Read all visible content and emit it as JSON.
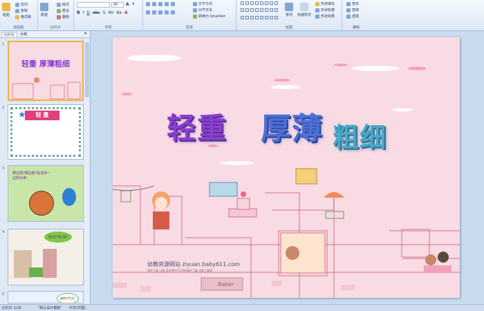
{
  "ribbon": {
    "clipboard": {
      "paste": "粘贴",
      "cut": "剪切",
      "copy": "复制",
      "format_painter": "格式刷",
      "label": "剪贴板"
    },
    "slides": {
      "new_slide": "新建\n幻灯片",
      "layout": "版式",
      "reset": "重设",
      "delete": "删除",
      "label": "幻灯片"
    },
    "font": {
      "font_name": "",
      "font_size": "88",
      "label": "字体"
    },
    "paragraph": {
      "text_direction": "文字方向",
      "align_text": "对齐文本",
      "smartart": "转换为 SmartArt",
      "label": "段落"
    },
    "drawing": {
      "arrange": "排列",
      "quick_styles": "快速样式",
      "shape_fill": "形状填充",
      "shape_outline": "形状轮廓",
      "shape_effects": "形状效果",
      "label": "绘图"
    },
    "editing": {
      "find": "查找",
      "replace": "替换",
      "select": "选择",
      "label": "编辑"
    }
  },
  "panel": {
    "tab_slides": "幻灯片",
    "tab_outline": "大纲",
    "thumbs": [
      {
        "num": "1",
        "text": "轻重 厚薄粗细"
      },
      {
        "num": "2",
        "text": "轻 重"
      },
      {
        "num": "3",
        "text": "哪边轻?哪边重?说说你一边想出来!"
      },
      {
        "num": "4",
        "text": "哪边轻?哪边重?"
      },
      {
        "num": "5",
        "text": "谁的力气大?"
      }
    ]
  },
  "slide": {
    "title_part1": "轻重",
    "title_part2": "厚薄",
    "title_part3": "粗细",
    "watermark": "幼教资源网站 ziyuan.baby611.com",
    "watermark_sub": "课件下载  儿歌  音乐MP3  FLASH课件下载  试卷下载等",
    "sign": "Baker"
  },
  "status": {
    "slide_count": "幻灯片 1/16",
    "theme": "\"默认设计模板\"",
    "language": "中文(中国)"
  },
  "colors": {
    "slide_bg": "#f9dbe4",
    "title_purple": "#8a3fd0",
    "title_blue": "#4b6fd6",
    "title_teal": "#48a8c8",
    "selection": "#f2b13a"
  }
}
